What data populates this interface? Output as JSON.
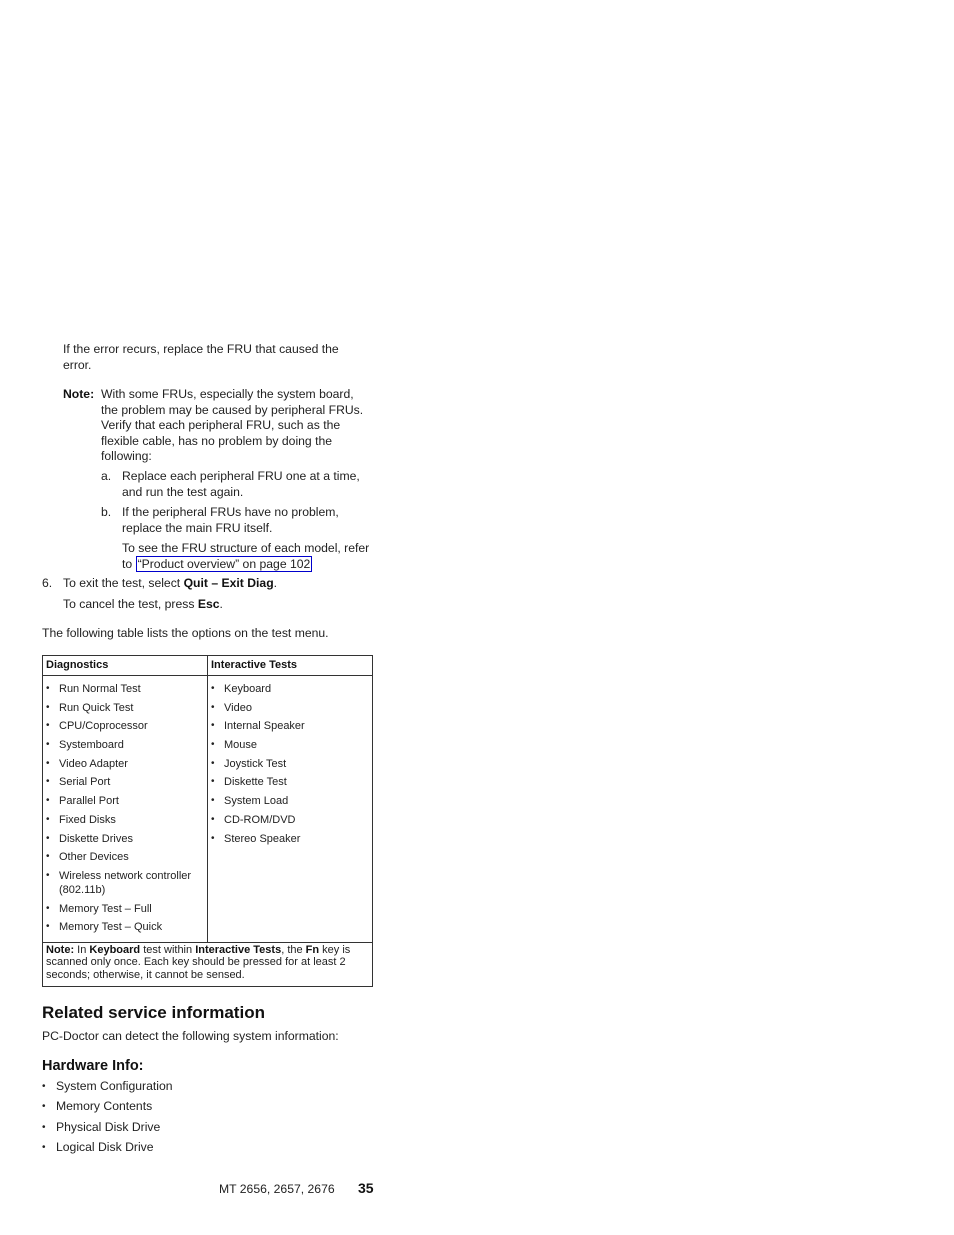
{
  "intro_paragraph": "If the error recurs, replace the FRU that caused the error.",
  "note": {
    "label": "Note:",
    "text": "With some FRUs, especially the system board, the problem may be caused by peripheral FRUs. Verify that each peripheral FRU, such as the flexible cable, has no problem by doing the following:",
    "steps": [
      {
        "marker": "a.",
        "text": "Replace each peripheral FRU one at a time, and run the test again."
      },
      {
        "marker": "b.",
        "text": "If the peripheral FRUs have no problem, replace the main FRU itself."
      }
    ],
    "see_also_prefix": "To see the FRU structure of each model, refer to ",
    "see_also_link": "“Product overview” on page 102"
  },
  "step6": {
    "number": "6.",
    "text_prefix": "To exit the test, select ",
    "text_bold": "Quit – Exit Diag",
    "text_suffix": ".",
    "cancel_prefix": "To cancel the test, press ",
    "cancel_bold": "Esc",
    "cancel_suffix": "."
  },
  "table_intro": "The following table lists the options on the test menu.",
  "table": {
    "headers": [
      "Diagnostics",
      "Interactive Tests"
    ],
    "diagnostics": [
      "Run Normal Test",
      "Run Quick Test",
      "CPU/Coprocessor",
      "Systemboard",
      "Video Adapter",
      "Serial Port",
      "Parallel Port",
      "Fixed Disks",
      "Diskette Drives",
      "Other Devices",
      "Wireless network controller (802.11b)",
      "Memory Test – Full",
      "Memory Test – Quick"
    ],
    "interactive": [
      "Keyboard",
      "Video",
      "Internal Speaker",
      "Mouse",
      "Joystick Test",
      "Diskette Test",
      "System Load",
      "CD-ROM/DVD",
      "Stereo Speaker"
    ],
    "note": {
      "label": "Note:",
      "p1": " In ",
      "b1": "Keyboard",
      "p2": " test within ",
      "b2": "Interactive Tests",
      "p3": ", the ",
      "b3": "Fn",
      "p4": " key is scanned only once. Each key should be pressed for at least 2 seconds; otherwise, it cannot be sensed."
    }
  },
  "related": {
    "heading": "Related service information",
    "text": "PC-Doctor can detect the following system information:",
    "hardware_heading": "Hardware Info:",
    "hardware_items": [
      "System Configuration",
      "Memory Contents",
      "Physical Disk Drive",
      "Logical Disk Drive"
    ]
  },
  "footer": {
    "models": "MT 2656, 2657, 2676",
    "page_number": "35"
  }
}
